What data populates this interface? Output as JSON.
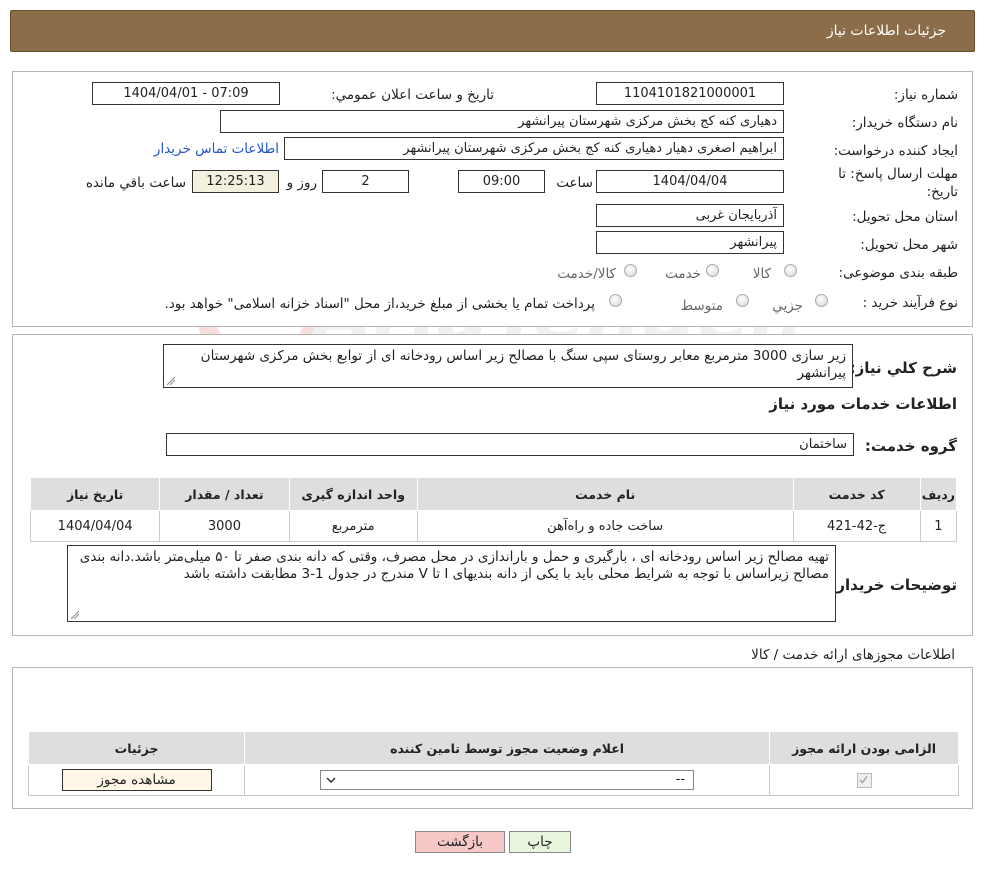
{
  "header": {
    "title": "جزئیات اطلاعات نیاز"
  },
  "fields": {
    "need_number_label": "شماره نیاز:",
    "need_number": "1104101821000001",
    "announce_label": "تاریخ و ساعت اعلان عمومي:",
    "announce_value": "1404/04/01 - 07:09",
    "buyer_org_label": "نام دستگاه خريدار:",
    "buyer_org": "دهیاری کنه کج بخش مرکزی شهرستان پیرانشهر",
    "requester_label": "ايجاد کننده درخواست:",
    "requester": "ابراهیم اصغری دهیار دهیاری کنه کج بخش مرکزی شهرستان پیرانشهر",
    "contact_link": "اطلاعات تماس خريدار",
    "deadline_label_1": "مهلت ارسال پاسخ: تا",
    "deadline_label_2": "تاريخ:",
    "deadline_date": "1404/04/04",
    "time_label": "ساعت",
    "deadline_time": "09:00",
    "days_value": "2",
    "days_label": "روز و",
    "remaining_time": "12:25:13",
    "remaining_label": "ساعت باقي مانده",
    "province_label": "استان محل تحويل:",
    "province": "آذربايجان غربی",
    "city_label": "شهر محل تحويل:",
    "city": "پیرانشهر",
    "category_label": "طبقه بندی موضوعی:",
    "category_options": [
      "کالا",
      "خدمت",
      "کالا/خدمت"
    ],
    "process_label": "نوع فرآيند خريد :",
    "process_options": [
      "جزيي",
      "متوسط"
    ],
    "process_note": "پرداخت تمام یا بخشی از مبلغ خرید،از محل \"اسناد خزانه اسلامی\" خواهد بود."
  },
  "summary": {
    "label": "شرح کلي نياز:",
    "text": "زیر سازی 3000 مترمربع معابر روستای سپی سنگ با مصالح زیر اساس رودخانه ای از توابع بخش مرکزی شهرستان پیرانشهر"
  },
  "services": {
    "heading": "اطلاعات خدمات مورد نياز",
    "group_label": "گروه خدمت:",
    "group_value": "ساختمان",
    "columns": [
      "رديف",
      "کد خدمت",
      "نام خدمت",
      "واحد اندازه گيری",
      "تعداد / مقدار",
      "تاريخ نياز"
    ],
    "rows": [
      [
        "1",
        "ج-42-421",
        "ساخت جاده و راه‌آهن",
        "مترمربع",
        "3000",
        "1404/04/04"
      ]
    ]
  },
  "buyer_notes": {
    "label": "توضيحات خريدار:",
    "text": "تهیه مصالح زیر اساس  رودخانه ای ، بارگیری و حمل و باراندازی در محل مصرف، وقتی که دانه بندی صفر تا ۵۰ میلی‌متر باشد.دانه بندی مصالح زیراساس با توجه به شرایط محلی باید با یکی از دانه بندیهای I تا V مندرج در جدول 1-3 مطابقت داشته باشد"
  },
  "permits": {
    "heading": "اطلاعات مجوزهای ارائه خدمت / کالا",
    "columns": [
      "الزامی بودن ارائه مجوز",
      "اعلام وضعيت مجوز توسط تامين کننده",
      "جزئيات"
    ],
    "select_value": "--",
    "view_button": "مشاهده مجوز"
  },
  "actions": {
    "print": "چاپ",
    "back": "بازگشت"
  },
  "colors": {
    "header_bg": "#8b6d4a",
    "back_bg": "#f7c8c8",
    "print_bg": "#e6f5dc",
    "link": "#2255cc"
  }
}
